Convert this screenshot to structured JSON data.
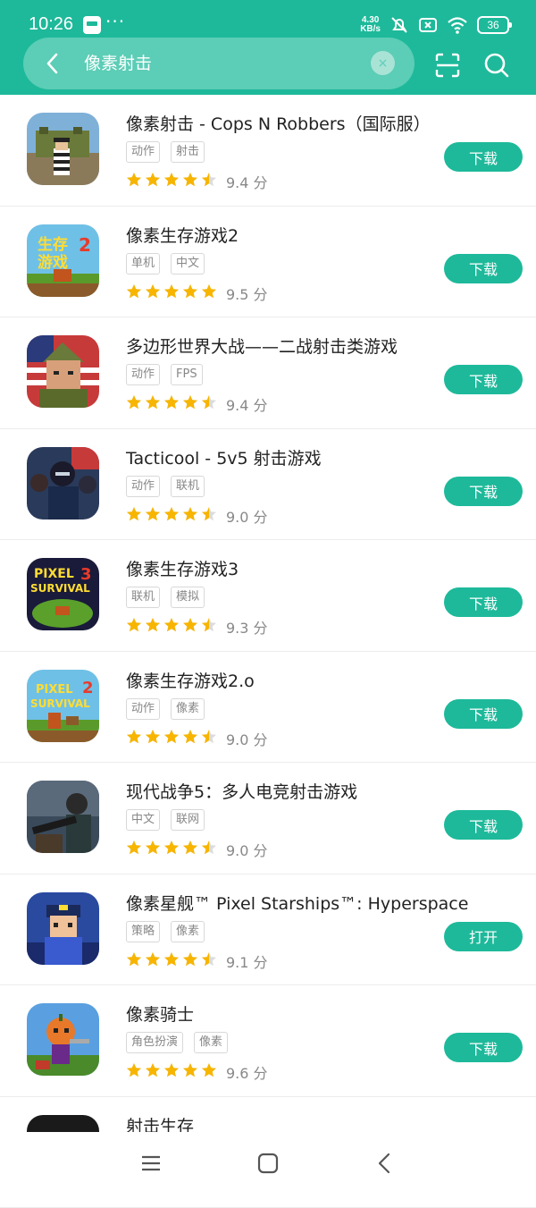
{
  "status": {
    "time": "10:26",
    "speed_value": "4.30",
    "speed_unit": "KB/s",
    "battery": "36"
  },
  "search": {
    "query": "像素射击",
    "clear_label": "×"
  },
  "colors": {
    "brand": "#1db99a",
    "star": "#f7b500"
  },
  "apps": [
    {
      "title": "像素射击 - Cops N Robbers（国际服）",
      "tags": [
        "动作",
        "射击"
      ],
      "rating": 4.5,
      "score": "9.4 分",
      "button": "下载",
      "icon": "cops-robbers-icon"
    },
    {
      "title": "像素生存游戏2",
      "tags": [
        "单机",
        "中文"
      ],
      "rating": 5,
      "score": "9.5 分",
      "button": "下载",
      "icon": "survival-2-icon"
    },
    {
      "title": "多边形世界大战——二战射击类游戏",
      "tags": [
        "动作",
        "FPS"
      ],
      "rating": 4.5,
      "score": "9.4 分",
      "button": "下载",
      "icon": "polygon-soldier-icon"
    },
    {
      "title": "Tacticool - 5v5 射击游戏",
      "tags": [
        "动作",
        "联机"
      ],
      "rating": 4.5,
      "score": "9.0 分",
      "button": "下载",
      "icon": "tacticool-icon"
    },
    {
      "title": "像素生存游戏3",
      "tags": [
        "联机",
        "模拟"
      ],
      "rating": 4.5,
      "score": "9.3 分",
      "button": "下载",
      "icon": "pixel-survival-3-icon"
    },
    {
      "title": "像素生存游戏2.o",
      "tags": [
        "动作",
        "像素"
      ],
      "rating": 4.5,
      "score": "9.0 分",
      "button": "下载",
      "icon": "pixel-survival-2o-icon"
    },
    {
      "title": "现代战争5：多人电竞射击游戏",
      "tags": [
        "中文",
        "联网"
      ],
      "rating": 4.5,
      "score": "9.0 分",
      "button": "下载",
      "icon": "modern-combat-icon"
    },
    {
      "title": "像素星舰™ Pixel Starships™: Hyperspace",
      "tags": [
        "策略",
        "像素"
      ],
      "rating": 4.5,
      "score": "9.1 分",
      "button": "打开",
      "icon": "pixel-starships-icon"
    },
    {
      "title": "像素骑士",
      "tags": [
        "角色扮演",
        "像素"
      ],
      "rating": 5,
      "score": "9.6 分",
      "button": "下载",
      "icon": "pixel-knight-icon"
    },
    {
      "title": "射击生存",
      "tags": [],
      "rating": 0,
      "score": "",
      "button": "",
      "icon": "shoot-survival-icon"
    }
  ]
}
